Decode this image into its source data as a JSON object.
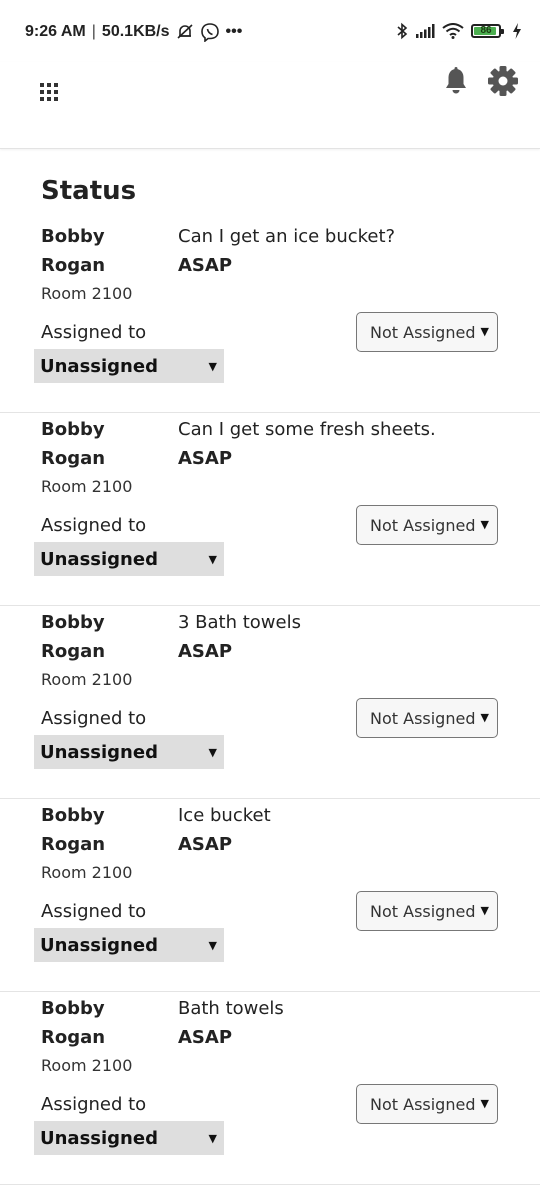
{
  "statusbar": {
    "time": "9:26 AM",
    "separator": "|",
    "speed": "50.1KB/s",
    "more": "•••",
    "battery_level": "86",
    "icons": [
      "alarm-off-icon",
      "viber-icon",
      "bluetooth-icon",
      "signal-icon",
      "wifi-icon",
      "battery-icon",
      "charging-icon"
    ]
  },
  "appbar": {
    "icons": [
      "apps-grid-icon",
      "bell-icon",
      "gear-icon"
    ]
  },
  "main": {
    "title": "Status",
    "assigned_label": "Assigned to",
    "requests": [
      {
        "first_name": "Bobby",
        "last_name": "Rogan",
        "room": "Room 2100",
        "request": "Can I get an ice bucket?",
        "priority": "ASAP",
        "assignee": "Unassigned",
        "status": "Not Assigned"
      },
      {
        "first_name": "Bobby",
        "last_name": "Rogan",
        "room": "Room 2100",
        "request": "Can I get some fresh sheets.",
        "priority": "ASAP",
        "assignee": "Unassigned",
        "status": "Not Assigned"
      },
      {
        "first_name": "Bobby",
        "last_name": "Rogan",
        "room": "Room 2100",
        "request": "3 Bath towels",
        "priority": "ASAP",
        "assignee": "Unassigned",
        "status": "Not Assigned"
      },
      {
        "first_name": "Bobby",
        "last_name": "Rogan",
        "room": "Room 2100",
        "request": "Ice bucket",
        "priority": "ASAP",
        "assignee": "Unassigned",
        "status": "Not Assigned"
      },
      {
        "first_name": "Bobby",
        "last_name": "Rogan",
        "room": "Room 2100",
        "request": "Bath towels",
        "priority": "ASAP",
        "assignee": "Unassigned",
        "status": "Not Assigned"
      }
    ]
  },
  "colors": {
    "battery_fill": "#4caf50",
    "select_bg": "#dedede",
    "divider": "#e4e4e4"
  }
}
